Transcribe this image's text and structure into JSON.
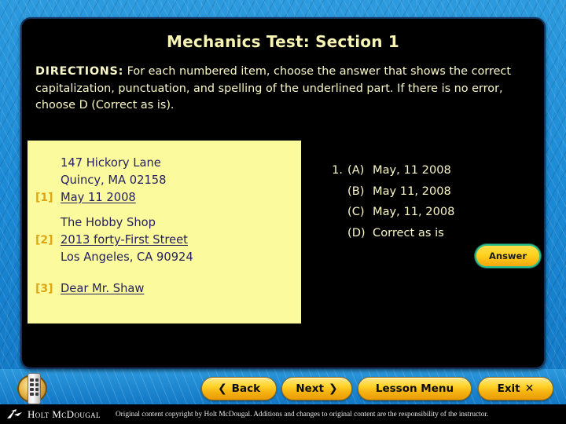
{
  "slide": {
    "title": "Mechanics Test: Section 1",
    "directions_label": "DIRECTIONS:",
    "directions_text": " For each numbered item, choose the answer that shows the correct capitalization, punctuation, and spelling of the underlined part. If there is no error, choose D (Correct as is).",
    "title_color": "#f7f4b4",
    "panel_bg": "#000000"
  },
  "letter_box": {
    "bg_color": "#fbfa9d",
    "text_color": "#241f5e",
    "tag_color": "#dda615",
    "blocks": [
      {
        "lines": [
          {
            "tag": "",
            "text": "147 Hickory Lane",
            "underlined": false
          },
          {
            "tag": "",
            "text": "Quincy, MA 02158",
            "underlined": false
          },
          {
            "tag": "[1]",
            "text": "May 11 2008",
            "underlined": true
          }
        ]
      },
      {
        "lines": [
          {
            "tag": "",
            "text": "The Hobby Shop",
            "underlined": false
          },
          {
            "tag": "[2]",
            "text": "2013 forty-First Street",
            "underlined": true
          },
          {
            "tag": "",
            "text": "Los Angeles, CA 90924",
            "underlined": false
          }
        ]
      },
      {
        "lines": [
          {
            "tag": "[3]",
            "text": "Dear Mr. Shaw",
            "underlined": true
          }
        ]
      }
    ]
  },
  "question": {
    "number": "1.",
    "choices": [
      {
        "letter": "(A)",
        "text": "May, 11 2008"
      },
      {
        "letter": "(B)",
        "text": "May 11, 2008"
      },
      {
        "letter": "(C)",
        "text": "May, 11, 2008"
      },
      {
        "letter": "(D)",
        "text": "Correct as is"
      }
    ]
  },
  "answer_button": {
    "label": "Answer"
  },
  "nav": {
    "back": {
      "label": "Back",
      "glyph": "❮"
    },
    "next": {
      "label": "Next",
      "glyph": "❯"
    },
    "lesson_menu": {
      "label": "Lesson Menu"
    },
    "exit": {
      "label": "Exit",
      "glyph": "✕"
    }
  },
  "footer": {
    "brand": "Holt McDougal",
    "copyright": "Original content copyright by Holt McDougal.  Additions and changes to original content are the responsibility of the instructor."
  }
}
